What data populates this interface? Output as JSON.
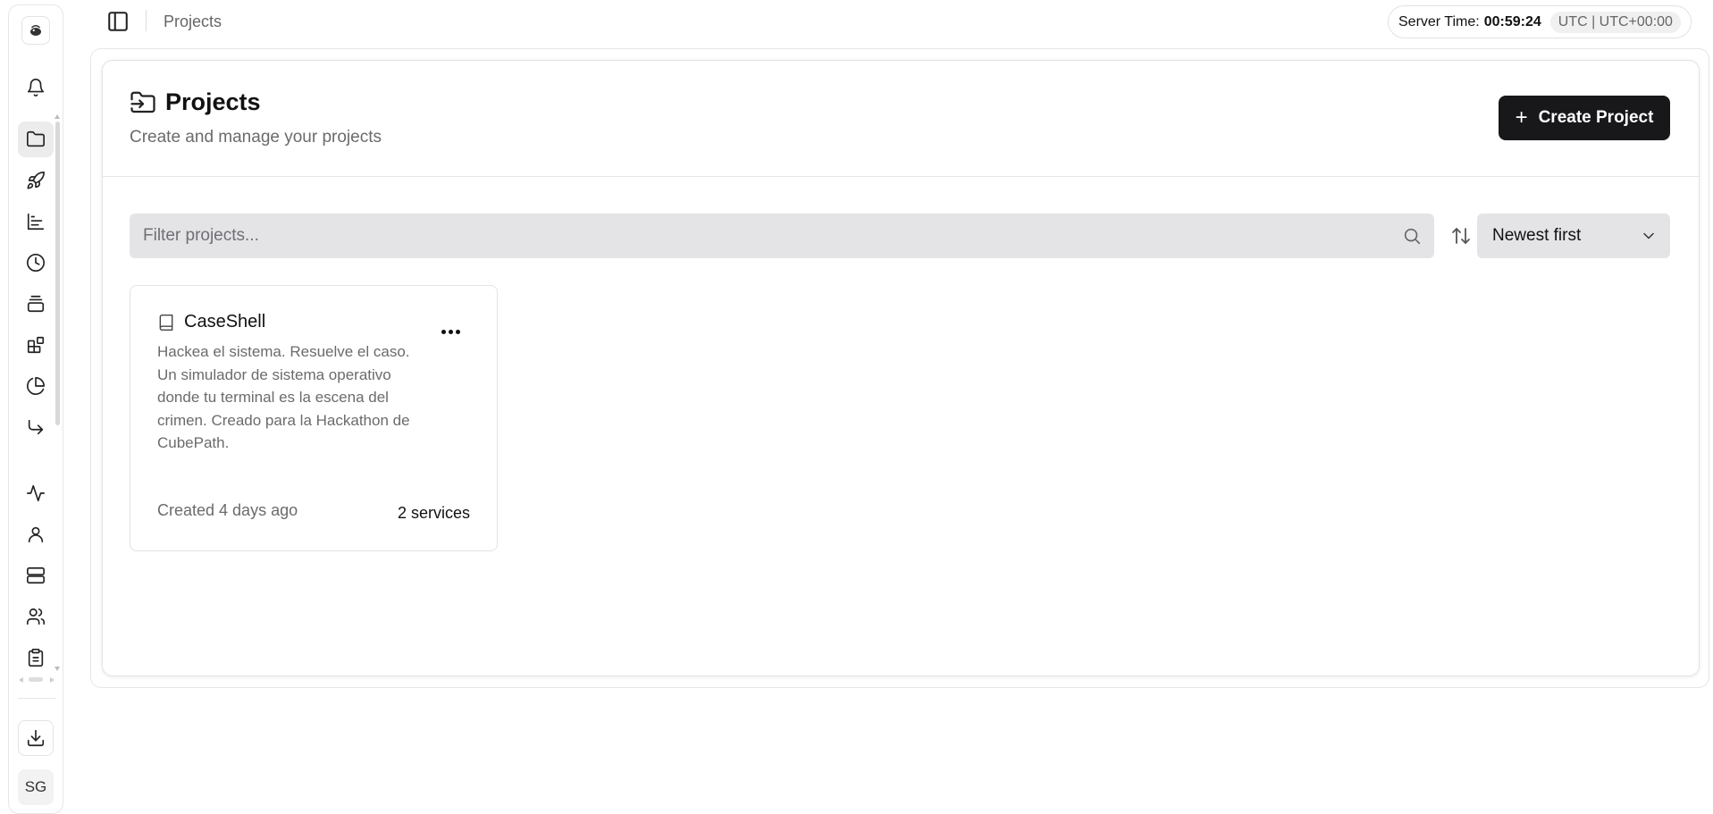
{
  "sidebar": {
    "nav": [
      {
        "name": "notifications",
        "icon": "bell-icon"
      },
      {
        "name": "projects",
        "icon": "folder-icon",
        "active": true
      },
      {
        "name": "deployments",
        "icon": "rocket-icon"
      },
      {
        "name": "monitoring",
        "icon": "bar-chart-icon"
      },
      {
        "name": "schedules",
        "icon": "clock-icon"
      },
      {
        "name": "queues",
        "icon": "layers-icon"
      },
      {
        "name": "templates",
        "icon": "blocks-icon"
      },
      {
        "name": "usage",
        "icon": "pie-chart-icon"
      },
      {
        "name": "redirects",
        "icon": "forward-arrow-icon"
      },
      {
        "name": "activity",
        "icon": "activity-icon"
      },
      {
        "name": "profile",
        "icon": "user-icon"
      },
      {
        "name": "servers",
        "icon": "server-icon"
      },
      {
        "name": "team",
        "icon": "users-icon"
      },
      {
        "name": "audit",
        "icon": "clipboard-icon"
      }
    ],
    "download_icon": "download-icon",
    "avatar_initials": "SG"
  },
  "header": {
    "breadcrumb": "Projects",
    "server_time_label": "Server Time:",
    "server_time_value": "00:59:24",
    "timezone": "UTC | UTC+00:00"
  },
  "page": {
    "title": "Projects",
    "subtitle": "Create and manage your projects",
    "create_button": "Create Project",
    "filter_placeholder": "Filter projects...",
    "sort_selected": "Newest first"
  },
  "projects": [
    {
      "name": "CaseShell",
      "description": "Hackea el sistema. Resuelve el caso. Un simulador de sistema operativo donde tu terminal es la escena del crimen. Creado para la Hackathon de CubePath.",
      "created": "Created 4 days ago",
      "services": "2 services"
    }
  ],
  "colors": {
    "primary_button": "#18181b",
    "input_bg": "#e4e4e7",
    "active_nav_bg": "#ececec"
  }
}
